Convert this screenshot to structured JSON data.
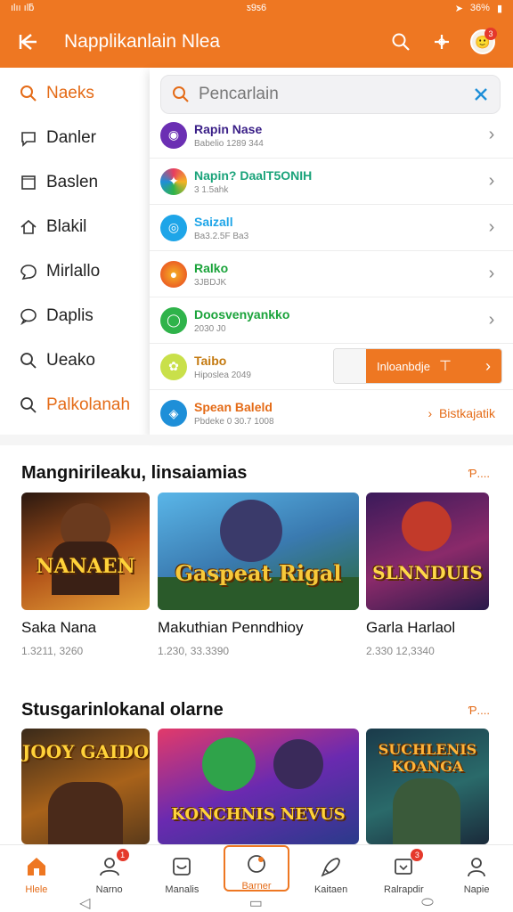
{
  "status_bar": {
    "left": "ılıı ılƃ",
    "center": "ƽ9ƽ6",
    "right": "36%"
  },
  "app_bar": {
    "title": "Napplikanlain Nlea"
  },
  "sidebar": {
    "items": [
      {
        "label": "Naeks"
      },
      {
        "label": "Danler"
      },
      {
        "label": "Baslen"
      },
      {
        "label": "Blakil"
      },
      {
        "label": "Mirlallo"
      },
      {
        "label": "Daplis"
      },
      {
        "label": "Ueako"
      },
      {
        "label": "Palkolanah"
      }
    ]
  },
  "search": {
    "placeholder": "Pencarlain"
  },
  "results": [
    {
      "name": "Rapin Nase",
      "sub": "Babelio 1289 344",
      "color": "#6b2fb3",
      "name_color": "#3a1f87"
    },
    {
      "name": "Napin? DaalT5ONIH",
      "sub": "3 1.5ahk",
      "color": "#e83d5f",
      "name_color": "#1aa37a"
    },
    {
      "name": "Saizall",
      "sub": "Ba3.2.5F Ba3",
      "color": "#1ea5e8",
      "name_color": "#1ea5e8"
    },
    {
      "name": "Ralko",
      "sub": "3JBDJK",
      "color": "#ef6a23",
      "name_color": "#1aa33a"
    },
    {
      "name": "Doosvenyankko",
      "sub": "2030 J0",
      "color": "#2fb34a",
      "name_color": "#1aa33a"
    },
    {
      "name": "Taibo",
      "sub": "Hiposlea 2049",
      "color": "#c9e04a",
      "name_color": "#c47a10"
    },
    {
      "name": "Spean Baleld",
      "sub": "Pbdeke 0 30.7 1008",
      "color": "#1e8fd8",
      "name_color": "#e46b17"
    }
  ],
  "install_button": {
    "label": "Inloanbdje",
    "mid": "⊤"
  },
  "result_extra": {
    "label": "Bistkajatik"
  },
  "section1": {
    "title": "Mangnirileaku, linsaiamias",
    "more": "Ƥ....",
    "cards": [
      {
        "art": "NANAEN",
        "caption": "Saka Nana",
        "sub": "1.3211, 3260"
      },
      {
        "art": "Gaspeat Rigal",
        "caption": "Makuthian Penndhioy",
        "sub": "1.230, 33.3390"
      },
      {
        "art": "SLNNDUIS",
        "caption": "Garla Harlaol",
        "sub": "2.330 12,3340"
      }
    ]
  },
  "section2": {
    "title": "Stusgarinlokanal olarne",
    "more": "Ƥ....",
    "cards": [
      {
        "art": "JOOY GAIDO"
      },
      {
        "art": "KONCHNIS NEVUS"
      },
      {
        "art": "SUCHLENIS KOANGA"
      }
    ]
  },
  "bottom_nav": [
    {
      "label": "Hlele"
    },
    {
      "label": "Narno"
    },
    {
      "label": "Manalis"
    },
    {
      "label": "Barner"
    },
    {
      "label": "Kaitaen"
    },
    {
      "label": "Ralrapdir"
    },
    {
      "label": "Napie"
    }
  ],
  "badges": {
    "nav2": "1",
    "nav6": "3",
    "avatar": "3"
  },
  "colors": {
    "brand": "#ee7722",
    "accent_text": "#e46b17"
  }
}
